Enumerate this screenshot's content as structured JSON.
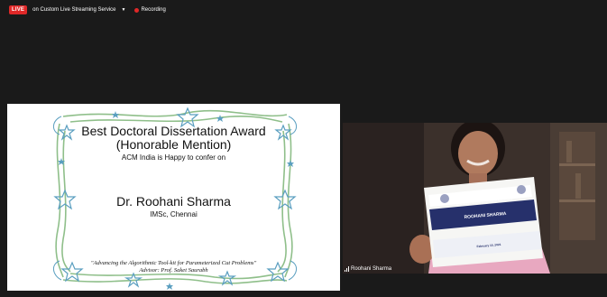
{
  "topbar": {
    "live_badge": "LIVE",
    "stream_label": "on Custom Live Streaming Service",
    "recording_label": "Recording"
  },
  "slide": {
    "title": "Best Doctoral Dissertation Award",
    "subtitle": "(Honorable Mention)",
    "confer": "ACM India is Happy to confer on",
    "recipient": "Dr. Roohani Sharma",
    "affiliation": "IMSc, Chennai",
    "thesis": "\"Advancing the Algorithmic Tool-kit for Parameterized Cut Problems\"",
    "advisor": "Advisor: Prof. Saket Saurabh"
  },
  "video": {
    "participant_name": "Roohani Sharma",
    "certificate": {
      "title": "ACM India Doctoral Dissertation Award 2021",
      "recipient": "ROOHANI SHARMA",
      "date": "February 10, 2021"
    }
  },
  "colors": {
    "live_red": "#e02828",
    "frame_green": "#8fbf8a",
    "star_blue": "#5b9fc0",
    "certificate_blue": "#26306b"
  }
}
